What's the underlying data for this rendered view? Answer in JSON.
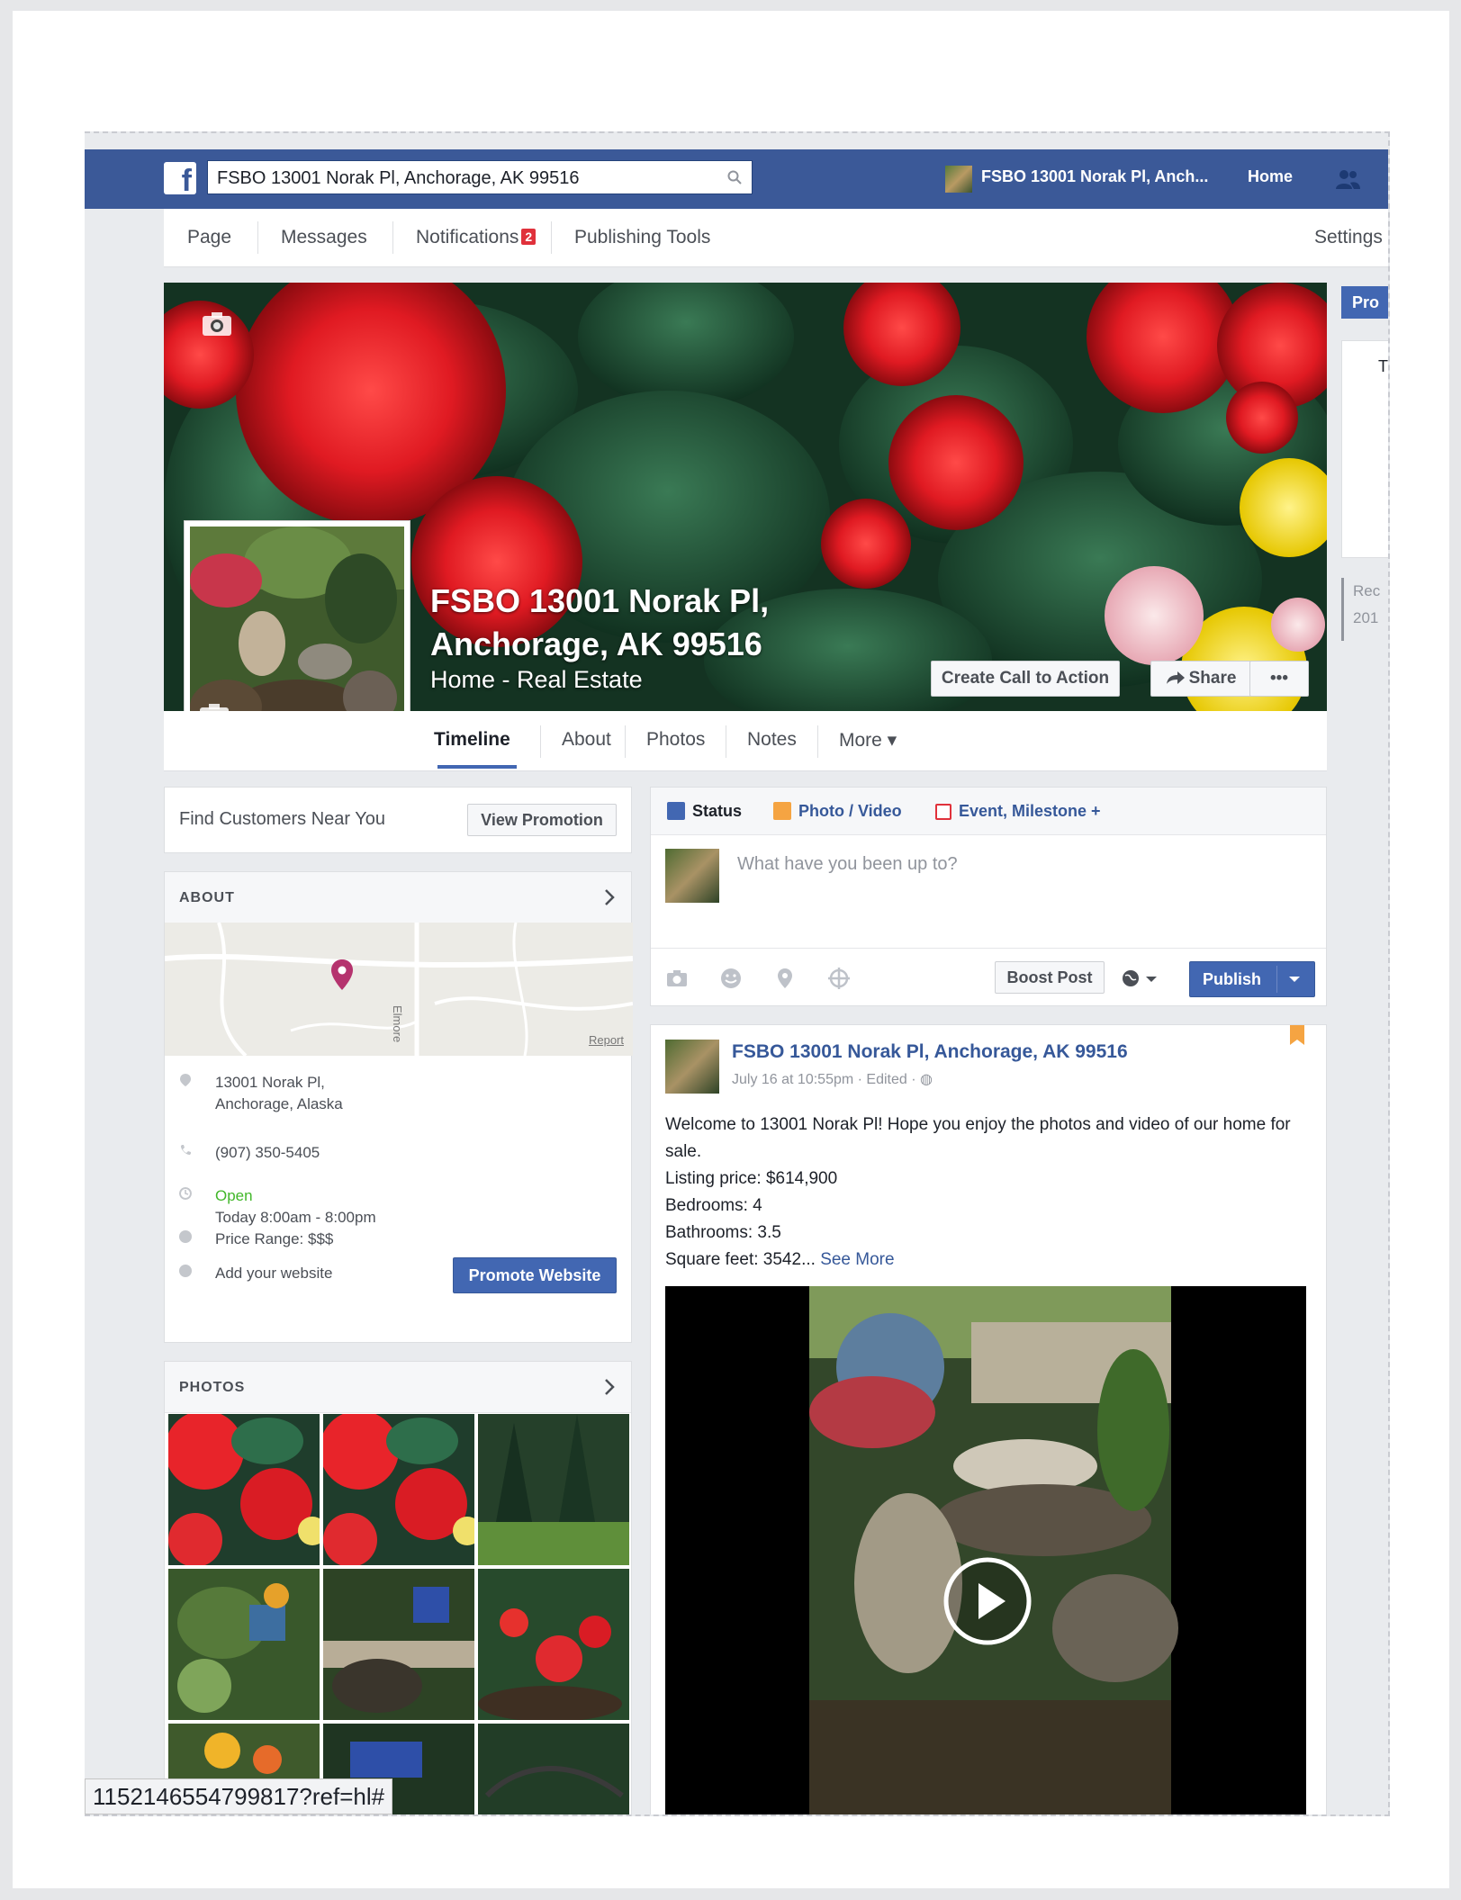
{
  "topbar": {
    "search_value": "FSBO 13001 Norak Pl, Anchorage, AK 99516",
    "profile_name": "FSBO 13001 Norak Pl, Anch...",
    "home_label": "Home",
    "logo_letter": "f",
    "brand_color": "#3b5998"
  },
  "page_nav": {
    "items": [
      "Page",
      "Messages",
      "Notifications",
      "Publishing Tools"
    ],
    "notifications_badge": "2",
    "settings_label": "Settings"
  },
  "cover": {
    "title_line1": "FSBO 13001 Norak Pl,",
    "title_line2": "Anchorage, AK 99516",
    "subtitle": "Home - Real Estate",
    "cta_label": "Create Call to Action",
    "share_label": "Share",
    "more_label": "•••"
  },
  "timeline_tabs": {
    "items": [
      "Timeline",
      "About",
      "Photos",
      "Notes",
      "More ▾"
    ],
    "active": "Timeline"
  },
  "right_column": {
    "button_label": "Pro",
    "box_text": "T",
    "rec_label": "Rec",
    "year_label": "201"
  },
  "promo_card": {
    "label": "Find Customers Near You",
    "button_label": "View Promotion"
  },
  "about_card": {
    "title": "ABOUT",
    "map_street": "Elmore",
    "map_report": "Report",
    "address_line1": "13001 Norak Pl,",
    "address_line2": "Anchorage, Alaska",
    "phone": "(907) 350-5405",
    "open_label": "Open",
    "hours": "Today 8:00am - 8:00pm",
    "price_range": "Price Range: $$$",
    "add_website": "Add your website",
    "promote_button": "Promote Website"
  },
  "photos_card": {
    "title": "PHOTOS"
  },
  "composer": {
    "tab_status": "Status",
    "tab_photo": "Photo / Video",
    "tab_event": "Event, Milestone +",
    "placeholder": "What have you been up to?",
    "boost_label": "Boost Post",
    "publish_label": "Publish"
  },
  "post": {
    "author": "FSBO 13001 Norak Pl, Anchorage, AK 99516",
    "meta": "July 16 at 10:55pm · Edited · ◍",
    "line1": "Welcome to 13001 Norak Pl! Hope you enjoy the photos and video of our home for sale.",
    "line2": "Listing price: $614,900",
    "line3": "Bedrooms: 4",
    "line4": "Bathrooms: 3.5",
    "line5": "Square feet: 3542...",
    "see_more": "See More"
  },
  "status_url": "1152146554799817?ref=hl#"
}
